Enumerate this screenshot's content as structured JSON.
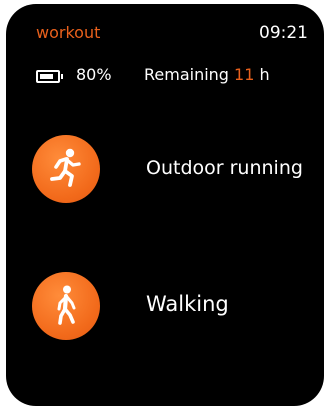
{
  "header": {
    "app_title": "workout",
    "time": "09:21"
  },
  "status": {
    "battery_level": 0.8,
    "battery_text": "80%",
    "remaining_prefix": "Remaining ",
    "remaining_hours": "11",
    "remaining_unit": " h"
  },
  "workouts": [
    {
      "label": "Outdoor running",
      "icon": "running-icon"
    },
    {
      "label": "Walking",
      "icon": "walking-icon"
    }
  ],
  "colors": {
    "accent": "#e8601c",
    "icon_bg": "#f26a1b",
    "background": "#000000",
    "text": "#ffffff"
  }
}
